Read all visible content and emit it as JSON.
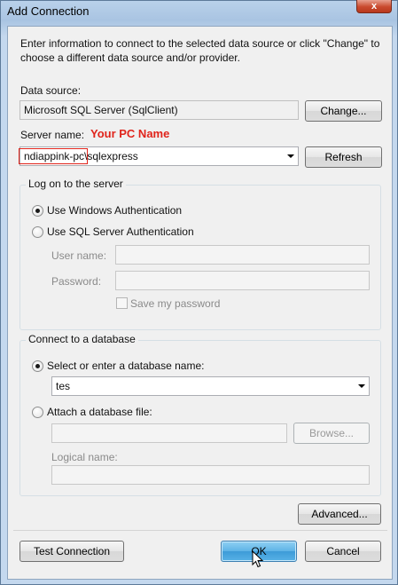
{
  "window": {
    "title": "Add Connection",
    "close_glyph": "x"
  },
  "intro_text": "Enter information to connect to the selected data source or click \"Change\" to choose a different data source and/or provider.",
  "data_source": {
    "label": "Data source:",
    "value": "Microsoft SQL Server (SqlClient)",
    "change_button": "Change..."
  },
  "server": {
    "label": "Server name:",
    "annotation": "Your PC Name",
    "value": "ndiappink-pc\\sqlexpress",
    "refresh_button": "Refresh"
  },
  "logon": {
    "group_title": "Log on to the server",
    "windows_auth": "Use Windows Authentication",
    "sql_auth": "Use SQL Server Authentication",
    "selected": "windows",
    "username_label": "User name:",
    "password_label": "Password:",
    "save_password_label": "Save my password"
  },
  "database": {
    "group_title": "Connect to a database",
    "select_option": "Select or enter a database name:",
    "db_name_value": "tes",
    "attach_option": "Attach a database file:",
    "browse_button": "Browse...",
    "logical_name_label": "Logical name:",
    "selected": "select"
  },
  "buttons": {
    "advanced": "Advanced...",
    "test_connection": "Test Connection",
    "ok": "OK",
    "cancel": "Cancel"
  },
  "icons": {
    "dropdown": "chevron-down-icon",
    "cursor": "mouse-pointer-icon"
  },
  "colors": {
    "annotation": "#e0241b",
    "default_button": "#5eb3e6",
    "window_frame": "#a9c4e2"
  }
}
